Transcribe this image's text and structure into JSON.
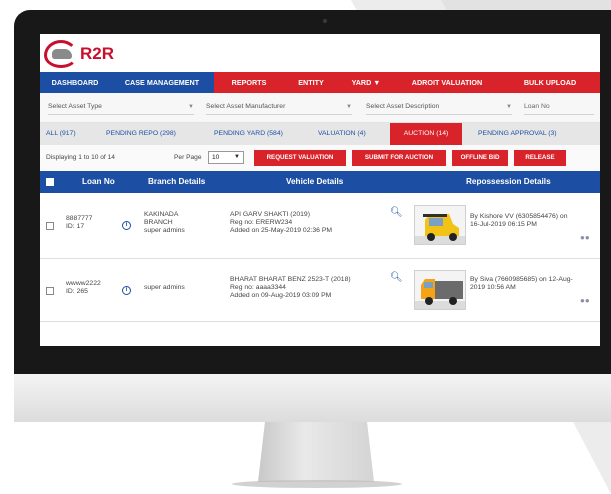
{
  "brand": {
    "name": "R2R"
  },
  "nav": [
    {
      "label": "DASHBOARD"
    },
    {
      "label": "CASE MANAGEMENT"
    },
    {
      "label": "REPORTS"
    },
    {
      "label": "ENTITY"
    },
    {
      "label": "YARD ▼"
    },
    {
      "label": "ADROIT VALUATION"
    },
    {
      "label": "BULK UPLOAD"
    }
  ],
  "filters": {
    "asset_type": "Select Asset Type",
    "asset_manufacturer": "Select Asset Manufacturer",
    "asset_description": "Select Asset Description",
    "loan_no": "Loan No"
  },
  "tabs": [
    {
      "label": "ALL (917)"
    },
    {
      "label": "PENDING REPO (298)"
    },
    {
      "label": "PENDING YARD (584)"
    },
    {
      "label": "VALUATION (4)"
    },
    {
      "label": "AUCTION (14)",
      "active": true
    },
    {
      "label": "PENDING APPROVAL (3)"
    }
  ],
  "toolbar": {
    "display_count": "Displaying 1 to 10 of 14",
    "per_page_label": "Per Page",
    "per_page_value": "10",
    "request_valuation": "REQUEST VALUATION",
    "submit_for_auction": "SUBMIT FOR AUCTION",
    "offline_bid": "OFFLINE BID",
    "release": "RELEASE"
  },
  "table": {
    "headers": {
      "loan_no": "Loan No",
      "branch_details": "Branch Details",
      "vehicle_details": "Vehicle Details",
      "repossession_details": "Repossession Details"
    },
    "rows": [
      {
        "loan_no": "8887777",
        "id": "ID: 17",
        "branch_line1": "KAKINADA",
        "branch_line2": "BRANCH",
        "branch_line3": "super admins",
        "vehicle_name": "API GARV SHAKTI (2019)",
        "reg_no": "Reg no: ERERW234",
        "added_on": "Added on 25-May-2019 02:36 PM",
        "repo_line1": "By Kishore VV (6305854476) on",
        "repo_line2": "16-Jul-2019 06:15 PM"
      },
      {
        "loan_no": "wwww2222",
        "id": "ID: 265",
        "branch_line1": "super admins",
        "vehicle_name": "BHARAT BHARAT BENZ 2523-T (2018)",
        "reg_no": "Reg no: aaaa3344",
        "added_on": "Added on 09-Aug-2019 03:09 PM",
        "repo_line1": "By Siva (7660985685) on 12-Aug-",
        "repo_line2": "2019 10:56 AM"
      }
    ]
  },
  "colors": {
    "brand_red": "#d8232a",
    "brand_blue": "#1c4fa3"
  }
}
